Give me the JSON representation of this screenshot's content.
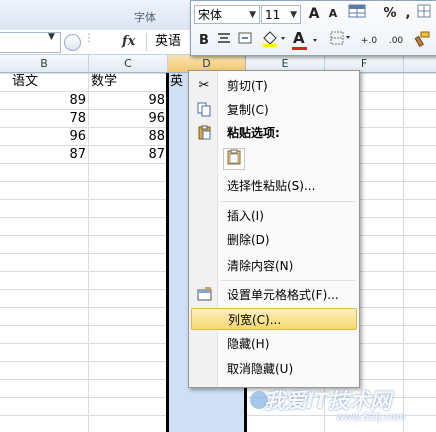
{
  "ribbon": {
    "font_group_label": "字体"
  },
  "formula_bar": {
    "function_icon": "fx",
    "value": "英语"
  },
  "mini_toolbar": {
    "font_name": "宋体",
    "font_size": "11",
    "grow_font": "A",
    "shrink_font": "A",
    "percent": "%",
    "comma": ",",
    "bold": "B",
    "font_color_letter": "A",
    "decimal_increase": "+.0",
    "decimal_decrease": ".00"
  },
  "columns": [
    "B",
    "C",
    "D",
    "E",
    "F"
  ],
  "sheet": {
    "header_row": {
      "B": "语文",
      "C": "数学",
      "D": "英语"
    },
    "rows": [
      {
        "B": "89",
        "C": "98"
      },
      {
        "B": "78",
        "C": "96"
      },
      {
        "B": "96",
        "C": "88"
      },
      {
        "B": "87",
        "C": "87"
      }
    ]
  },
  "context_menu": {
    "cut": "剪切(T)",
    "copy": "复制(C)",
    "paste_options": "粘贴选项:",
    "paste_special": "选择性粘贴(S)...",
    "insert": "插入(I)",
    "delete": "删除(D)",
    "clear_contents": "清除内容(N)",
    "format_cells": "设置单元格格式(F)...",
    "column_width": "列宽(C)...",
    "hide": "隐藏(H)",
    "unhide": "取消隐藏(U)"
  },
  "watermark": {
    "title": "我爱IT技术网",
    "url": "www.52ij.com"
  },
  "colors": {
    "selection": "#cfe0f5",
    "menu_highlight": "#f7d76b",
    "column_header_selected": "#f3c86e"
  }
}
